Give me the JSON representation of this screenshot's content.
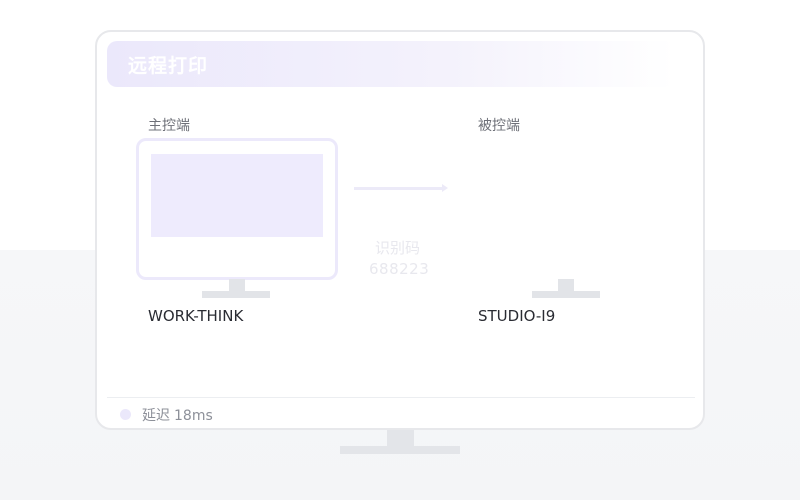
{
  "window": {
    "title": "远程打印"
  },
  "controller": {
    "label": "主控端",
    "device_name": "WORK-THINK"
  },
  "controlled": {
    "label": "被控端",
    "device_name": "STUDIO-I9"
  },
  "connection": {
    "code_label": "识别码",
    "code_value": "688223"
  },
  "status": {
    "latency_label": "延迟",
    "latency_value": "18ms",
    "dot_color": "#ebe8fb"
  },
  "colors": {
    "accent_light": "#eeebfd",
    "border": "#e7e8eb"
  }
}
